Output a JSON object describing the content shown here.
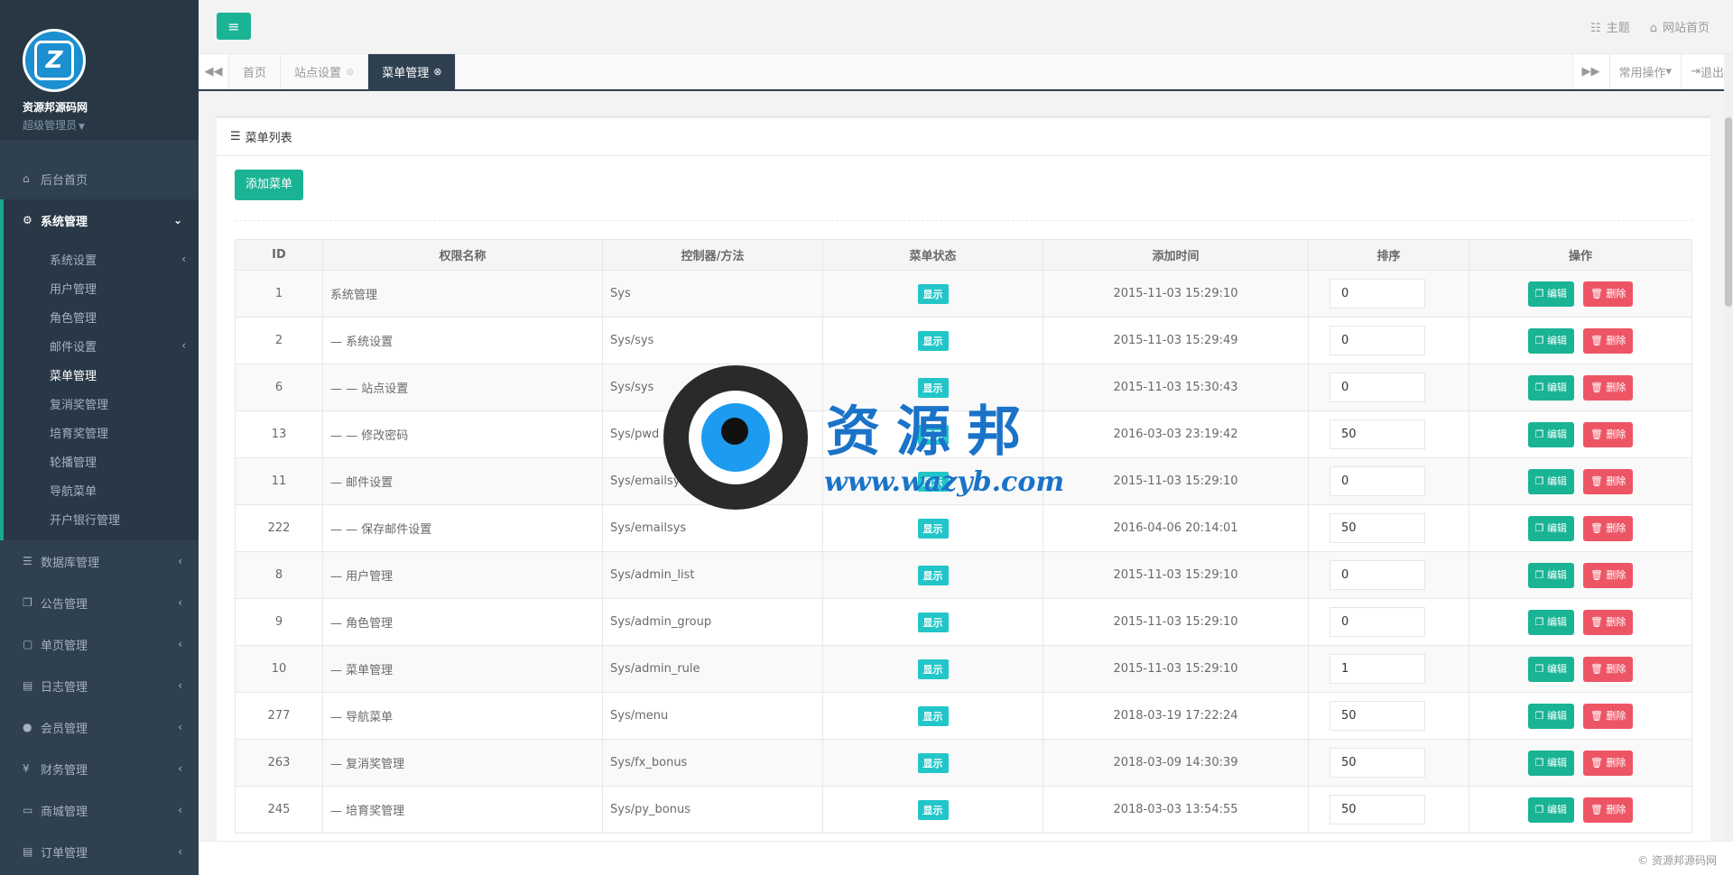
{
  "sidebar": {
    "site_name": "资源邦源码网",
    "role": "超级管理员",
    "nav": [
      {
        "label": "后台首页",
        "icon": "home-icon"
      },
      {
        "label": "系统管理",
        "icon": "gear-icon"
      },
      {
        "label": "数据库管理",
        "icon": "database-icon"
      },
      {
        "label": "公告管理",
        "icon": "copy-icon"
      },
      {
        "label": "单页管理",
        "icon": "file-icon"
      },
      {
        "label": "日志管理",
        "icon": "file-text-icon"
      },
      {
        "label": "会员管理",
        "icon": "user-icon"
      },
      {
        "label": "财务管理",
        "icon": "yen-icon"
      },
      {
        "label": "商城管理",
        "icon": "desktop-icon"
      },
      {
        "label": "订单管理",
        "icon": "file-alt-icon"
      }
    ],
    "sub": [
      "系统设置",
      "用户管理",
      "角色管理",
      "邮件设置",
      "菜单管理",
      "复消奖管理",
      "培育奖管理",
      "轮播管理",
      "导航菜单",
      "开户银行管理"
    ]
  },
  "top": {
    "theme": "主题",
    "home": "网站首页"
  },
  "tabs": [
    "首页",
    "站点设置",
    "菜单管理"
  ],
  "tabbar": {
    "common_ops": "常用操作",
    "logout": "退出"
  },
  "panel": {
    "title": "菜单列表",
    "add_button": "添加菜单"
  },
  "table": {
    "headers": [
      "ID",
      "权限名称",
      "控制器/方法",
      "菜单状态",
      "添加时间",
      "排序",
      "操作"
    ],
    "status_label": "显示",
    "edit_label": "编辑",
    "delete_label": "删除",
    "rows": [
      {
        "id": "1",
        "name": "系统管理",
        "ctrl": "Sys",
        "time": "2015-11-03 15:29:10",
        "sort": "0"
      },
      {
        "id": "2",
        "name": "— 系统设置",
        "ctrl": "Sys/sys",
        "time": "2015-11-03 15:29:49",
        "sort": "0"
      },
      {
        "id": "6",
        "name": "— — 站点设置",
        "ctrl": "Sys/sys",
        "time": "2015-11-03 15:30:43",
        "sort": "0"
      },
      {
        "id": "13",
        "name": "— — 修改密码",
        "ctrl": "Sys/pwd",
        "time": "2016-03-03 23:19:42",
        "sort": "50"
      },
      {
        "id": "11",
        "name": "— 邮件设置",
        "ctrl": "Sys/emailsys",
        "time": "2015-11-03 15:29:10",
        "sort": "0"
      },
      {
        "id": "222",
        "name": "— — 保存邮件设置",
        "ctrl": "Sys/emailsys",
        "time": "2016-04-06 20:14:01",
        "sort": "50"
      },
      {
        "id": "8",
        "name": "— 用户管理",
        "ctrl": "Sys/admin_list",
        "time": "2015-11-03 15:29:10",
        "sort": "0"
      },
      {
        "id": "9",
        "name": "— 角色管理",
        "ctrl": "Sys/admin_group",
        "time": "2015-11-03 15:29:10",
        "sort": "0"
      },
      {
        "id": "10",
        "name": "— 菜单管理",
        "ctrl": "Sys/admin_rule",
        "time": "2015-11-03 15:29:10",
        "sort": "1"
      },
      {
        "id": "277",
        "name": "— 导航菜单",
        "ctrl": "Sys/menu",
        "time": "2018-03-19 17:22:24",
        "sort": "50"
      },
      {
        "id": "263",
        "name": "— 复消奖管理",
        "ctrl": "Sys/fx_bonus",
        "time": "2018-03-09 14:30:39",
        "sort": "50"
      },
      {
        "id": "245",
        "name": "— 培育奖管理",
        "ctrl": "Sys/py_bonus",
        "time": "2018-03-03 13:54:55",
        "sort": "50"
      }
    ]
  },
  "watermark": {
    "text": "资源邦",
    "url": "www.wazyb.com"
  },
  "footer": "© 资源邦源码网"
}
